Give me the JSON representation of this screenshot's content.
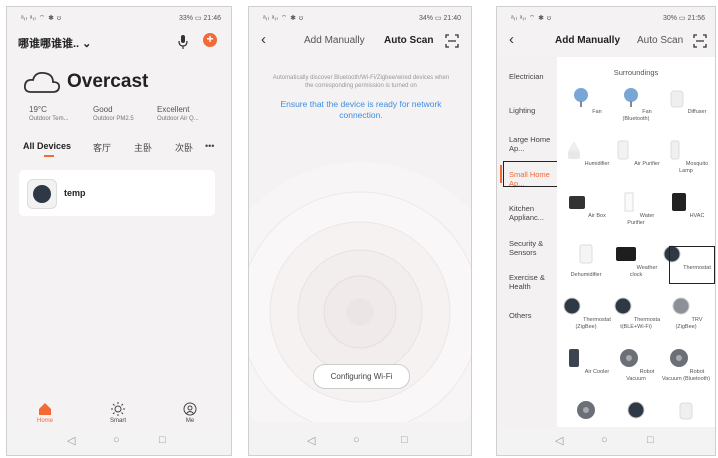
{
  "screen1": {
    "status_left": "ᵃᵢₗ ᵃᵢₗ ⌔ ✱ ʊ",
    "status_right": "33% ▭ 21:46",
    "home_name": "哪谁哪谁谁.. ⌄",
    "weather": "Overcast",
    "stats": [
      {
        "value": "19°C",
        "label": "Outdoor Tem..."
      },
      {
        "value": "Good",
        "label": "Outdoor PM2.5"
      },
      {
        "value": "Excellent",
        "label": "Outdoor Air Q..."
      }
    ],
    "rooms": [
      "All Devices",
      "客厅",
      "主卧",
      "次卧",
      "•••"
    ],
    "device_name": "temp",
    "tabs": [
      "Home",
      "Smart",
      "Me"
    ],
    "accent": "#f26a36"
  },
  "screen2": {
    "status_left": "ᵃᵢₗ ᵃᵢₗ ⌔ ✱ ʊ",
    "status_right": "34% ▭ 21:40",
    "tab_manual": "Add Manually",
    "tab_scan": "Auto Scan",
    "hint": "Automatically discover Bluetooth/Wi-Fi/Zigbee/wired devices when the corresponding permission is turned on",
    "ready": "Ensure that the device is ready for network connection.",
    "button": "Configuring Wi-Fi"
  },
  "screen3": {
    "status_left": "ᵃᵢₗ ᵃᵢₗ ⌔ ✱ ʊ",
    "status_right": "30% ▭ 21:56",
    "tab_manual": "Add Manually",
    "tab_scan": "Auto Scan",
    "categories": [
      "Electrician",
      "Lighting",
      "Large Home Ap...",
      "Small Home Ap...",
      "Kitchen Applianc...",
      "Security & Sensors",
      "Exercise & Health",
      "Others"
    ],
    "section": "Surroundings",
    "items": [
      "Fan",
      "Fan (Bluetooth)",
      "Diffuser",
      "Humidifier",
      "Air Purifier",
      "Mosquito Lamp",
      "Air Box",
      "Water Purifier",
      "HVAC",
      "Dehumidifier",
      "Weather clock",
      "Thermostat",
      "Thermostat (ZigBee)",
      "Thermosta t(BLE+Wi-Fi)",
      "TRV (ZigBee)",
      "Air Cooler",
      "Robot Vacuum",
      "Robot Vacuum (Bluetooth)",
      "",
      "",
      ""
    ]
  },
  "nav": {
    "back": "◁",
    "home": "○",
    "recent": "□"
  }
}
